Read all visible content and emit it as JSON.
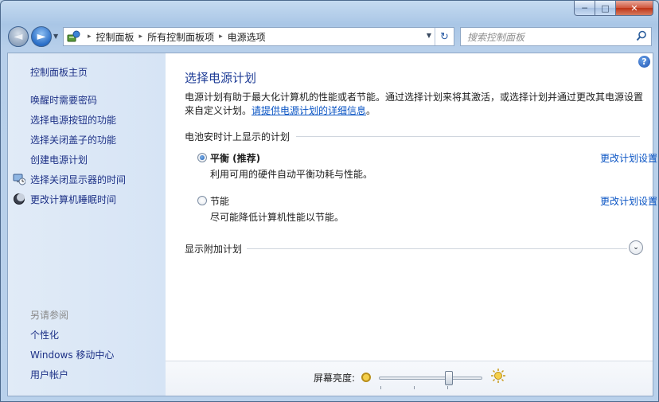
{
  "window": {
    "title": ""
  },
  "titlebar": {
    "min_label": "─",
    "max_label": "□",
    "close_label": "✕"
  },
  "nav": {
    "back_label": "◄",
    "forward_label": "►",
    "history_label": "▼"
  },
  "address": {
    "crumbs": [
      "控制面板",
      "所有控制面板项",
      "电源选项"
    ],
    "dropdown_label": "▼",
    "refresh_label": "↻"
  },
  "search": {
    "placeholder": "搜索控制面板"
  },
  "sidebar": {
    "home": "控制面板主页",
    "items": [
      {
        "label": "唤醒时需要密码",
        "icon": null
      },
      {
        "label": "选择电源按钮的功能",
        "icon": null
      },
      {
        "label": "选择关闭盖子的功能",
        "icon": null
      },
      {
        "label": "创建电源计划",
        "icon": null
      },
      {
        "label": "选择关闭显示器的时间",
        "icon": "monitor-clock-icon"
      },
      {
        "label": "更改计算机睡眠时间",
        "icon": "moon-icon"
      }
    ],
    "see_also_heading": "另请参阅",
    "see_also": [
      "个性化",
      "Windows 移动中心",
      "用户帐户"
    ]
  },
  "main": {
    "help_label": "?",
    "title": "选择电源计划",
    "description": "电源计划有助于最大化计算机的性能或者节能。通过选择计划来将其激活，或选择计划并通过更改其电源设置来自定义计划。",
    "details_link": "请提供电源计划的详细信息",
    "description_end": "。",
    "group_title": "电池安时计上显示的计划",
    "plans": [
      {
        "name": "平衡 (推荐)",
        "desc": "利用可用的硬件自动平衡功耗与性能。",
        "link": "更改计划设置",
        "selected": true
      },
      {
        "name": "节能",
        "desc": "尽可能降低计算机性能以节能。",
        "link": "更改计划设置",
        "selected": false
      }
    ],
    "more_plans": "显示附加计划",
    "expand_label": "⌄"
  },
  "brightness": {
    "label": "屏幕亮度:",
    "level": 0.68
  },
  "colors": {
    "link": "#0b55c4",
    "title": "#1e3c96",
    "sidebar_link": "#1e3287"
  }
}
